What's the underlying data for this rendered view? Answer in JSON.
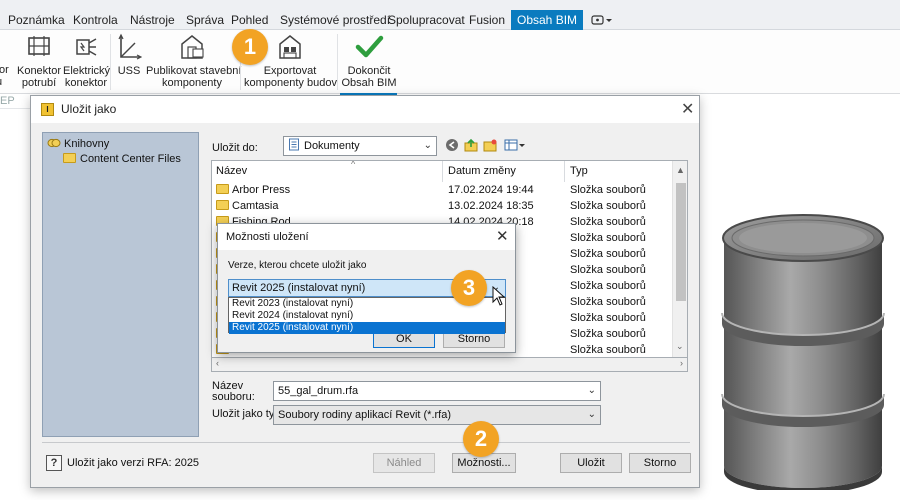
{
  "tabs": [
    {
      "label": "Poznámka",
      "active": false
    },
    {
      "label": "Kontrola",
      "active": false
    },
    {
      "label": "Nástroje",
      "active": false
    },
    {
      "label": "Správa",
      "active": false
    },
    {
      "label": "Pohled",
      "active": false
    },
    {
      "label": "Systémové prostředí",
      "active": false
    },
    {
      "label": "Spolupracovat",
      "active": false
    },
    {
      "label": "Fusion",
      "active": false
    },
    {
      "label": "Obsah BIM",
      "active": true
    }
  ],
  "ribbon": {
    "cut_label_top": "tor",
    "cut_label_bottom": "u",
    "konektor_potrubi": "Konektor\npotrubí",
    "elektricky_konektor": "Elektrický\nkonektor",
    "uss": "USS",
    "publikovat": "Publikovat stavební\nkomponenty",
    "exportovat": "Exportovat\nkomponenty budov",
    "dokoncit": "Dokončit\nObsah BIM",
    "mep_label": "EP"
  },
  "badges": {
    "one": "1",
    "two": "2",
    "three": "3"
  },
  "save_dialog": {
    "title": "Uložit jako",
    "close": "✕",
    "tree_root": "Knihovny",
    "tree_child": "Content Center Files",
    "save_in_label": "Uložit do:",
    "save_in_value": "Dokumenty",
    "columns": {
      "name": "Název",
      "date": "Datum změny",
      "type": "Typ"
    },
    "rows": [
      {
        "name": "Arbor Press",
        "date": "17.02.2024 19:44",
        "type": "Složka souborů"
      },
      {
        "name": "Camtasia",
        "date": "13.02.2024 18:35",
        "type": "Složka souborů"
      },
      {
        "name": "Fishing Rod",
        "date": "14.02.2024 20:18",
        "type": "Složka souborů"
      },
      {
        "name": "",
        "date": "",
        "type": "Složka souborů"
      },
      {
        "name": "",
        "date": "",
        "type": "Složka souborů"
      },
      {
        "name": "",
        "date": "",
        "type": "Složka souborů"
      },
      {
        "name": "",
        "date": "",
        "type": "Složka souborů"
      },
      {
        "name": "",
        "date": "",
        "type": "Složka souborů"
      },
      {
        "name": "",
        "date": "",
        "type": "Složka souborů"
      },
      {
        "name": "",
        "date": "",
        "type": "Složka souborů"
      },
      {
        "name": "",
        "date": "",
        "type": "Složka souborů"
      }
    ],
    "filename_label": "Název\nsouboru:",
    "filename_value": "55_gal_drum.rfa",
    "filetype_label": "Uložit jako typ:",
    "filetype_value": "Soubory rodiny aplikací Revit (*.rfa)",
    "version_note": "Uložit jako verzi RFA: 2025",
    "preview_button": "Náhled",
    "options_button": "Možnosti...",
    "save_button": "Uložit",
    "cancel_button": "Storno"
  },
  "options_dialog": {
    "title": "Možnosti uložení",
    "close": "✕",
    "prompt": "Verze, kterou chcete uložit jako",
    "selected": "Revit 2025 (instalovat nyní)",
    "options": [
      "Revit 2023 (instalovat nyní)",
      "Revit 2024 (instalovat nyní)",
      "Revit 2025 (instalovat nyní)"
    ],
    "ok": "OK",
    "cancel": "Storno"
  },
  "colors": {
    "accent": "#0a7bbf",
    "badge": "#f2a324",
    "checkmark": "#2e9e3e",
    "selection": "#0a73d1",
    "tree_pane": "#b9c6d6"
  }
}
